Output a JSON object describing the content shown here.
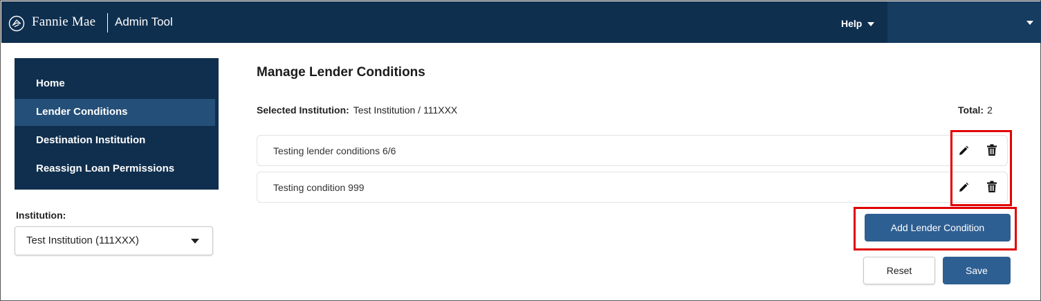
{
  "header": {
    "brand": "Fannie Mae",
    "app_name": "Admin Tool",
    "help_label": "Help",
    "logo_icon": "fannie-mae-logo-icon",
    "background_color": "#0f2f4f"
  },
  "sidebar": {
    "items": [
      {
        "label": "Home",
        "active": false
      },
      {
        "label": "Lender Conditions",
        "active": true
      },
      {
        "label": "Destination Institution",
        "active": false
      },
      {
        "label": "Reassign Loan Permissions",
        "active": false
      }
    ],
    "institution_label": "Institution:",
    "institution_value": "Test Institution (111XXX)"
  },
  "main": {
    "title": "Manage Lender Conditions",
    "selected_label": "Selected Institution:",
    "selected_value": "Test Institution / 111XXX",
    "total_label": "Total:",
    "total_value": "2",
    "conditions": [
      {
        "text": "Testing lender conditions 6/6",
        "actions": [
          "pencil-icon",
          "trash-icon"
        ]
      },
      {
        "text": "Testing condition 999",
        "actions": [
          "pencil-icon",
          "trash-icon"
        ]
      }
    ],
    "buttons": {
      "add": "Add Lender Condition",
      "reset": "Reset",
      "save": "Save"
    }
  },
  "colors": {
    "accent": "#2e5f92",
    "highlight": "#e00000"
  }
}
